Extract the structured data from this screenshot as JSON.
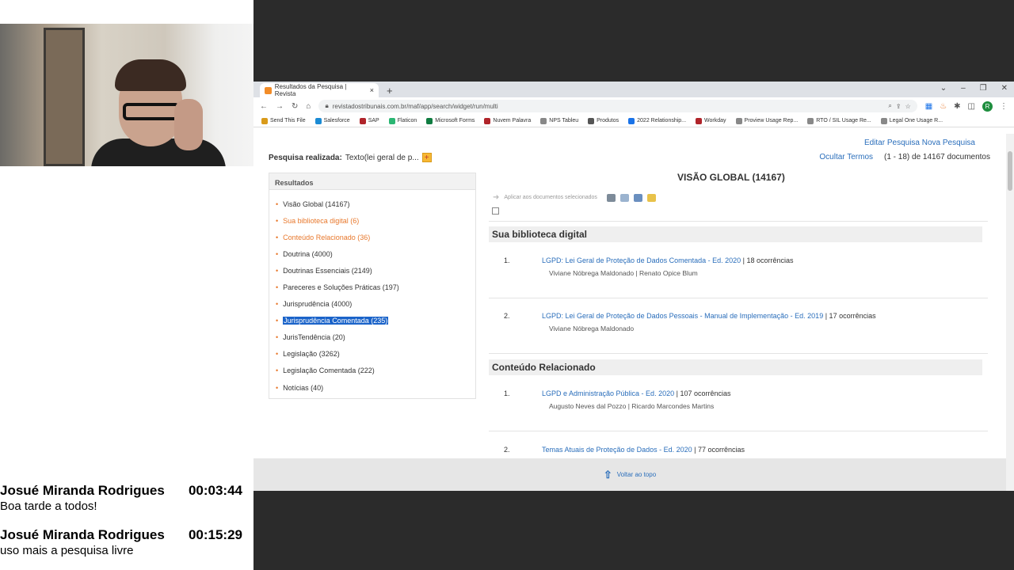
{
  "chat": [
    {
      "name": "Josué Miranda Rodrigues",
      "time": "00:03:44",
      "text": "Boa tarde a todos!"
    },
    {
      "name": "Josué Miranda Rodrigues",
      "time": "00:15:29",
      "text": "uso mais a pesquisa livre"
    }
  ],
  "browser": {
    "tab_title": "Resultados da Pesquisa | Revista",
    "tab_close": "×",
    "new_tab": "+",
    "url": "revistadostribunais.com.br/maf/app/search/widget/run/multi",
    "avatar_letter": "R",
    "bookmarks": [
      {
        "label": "Send This File",
        "color": "#d99a1a"
      },
      {
        "label": "Salesforce",
        "color": "#1b8bd4"
      },
      {
        "label": "SAP",
        "color": "#b0242a"
      },
      {
        "label": "Flaticon",
        "color": "#2bb673"
      },
      {
        "label": "Microsoft Forms",
        "color": "#107c41"
      },
      {
        "label": "Nuvem Palavra",
        "color": "#b0242a"
      },
      {
        "label": "NPS Tableu",
        "color": "#888888"
      },
      {
        "label": "Produtos",
        "color": "#555555"
      },
      {
        "label": "2022 Relationship...",
        "color": "#1a73e8"
      },
      {
        "label": "Workday",
        "color": "#b0242a"
      },
      {
        "label": "Proview Usage Rep...",
        "color": "#888888"
      },
      {
        "label": "RTO / SIL Usage Re...",
        "color": "#888888"
      },
      {
        "label": "Legal One Usage R...",
        "color": "#888888"
      }
    ]
  },
  "page": {
    "search_label": "Pesquisa realizada:",
    "search_value": "Texto(lei geral de p...",
    "plus": "+",
    "edit_search": "Editar Pesquisa",
    "new_search": "Nova Pesquisa",
    "hide_terms": "Ocultar Termos",
    "range": "(1 - 18) de 14167 documentos",
    "results_heading": "Resultados",
    "results": [
      {
        "label": "Visão Global (14167)",
        "style": "normal"
      },
      {
        "label": "Sua biblioteca digital (6)",
        "style": "orange"
      },
      {
        "label": "Conteúdo Relacionado (36)",
        "style": "orange"
      },
      {
        "label": "Doutrina (4000)",
        "style": "normal"
      },
      {
        "label": "Doutrinas Essenciais (2149)",
        "style": "normal"
      },
      {
        "label": "Pareceres e Soluções Práticas (197)",
        "style": "normal"
      },
      {
        "label": "Jurisprudência (4000)",
        "style": "normal"
      },
      {
        "label": "Jurisprudência Comentada (235)",
        "style": "selected"
      },
      {
        "label": "JurisTendência (20)",
        "style": "normal"
      },
      {
        "label": "Legislação (3262)",
        "style": "normal"
      },
      {
        "label": "Legislação Comentada (222)",
        "style": "normal"
      },
      {
        "label": "Notícias (40)",
        "style": "normal"
      }
    ],
    "main_title": "VISÃO GLOBAL (14167)",
    "apply_label": "Aplicar aos documentos selecionados",
    "sections": [
      {
        "title": "Sua biblioteca digital",
        "docs": [
          {
            "num": "1.",
            "title": "LGPD: Lei Geral de Proteção de Dados Comentada - Ed. 2020",
            "occ": "| 18 ocorrências",
            "authors": "Viviane Nóbrega Maldonado | Renato Opice Blum"
          },
          {
            "num": "2.",
            "title": "LGPD: Lei Geral de Proteção de Dados Pessoais - Manual de Implementação - Ed. 2019",
            "occ": "| 17 ocorrências",
            "authors": "Viviane Nóbrega Maldonado"
          }
        ]
      },
      {
        "title": "Conteúdo Relacionado",
        "docs": [
          {
            "num": "1.",
            "title": "LGPD e Administração Pública - Ed. 2020",
            "occ": "| 107 ocorrências",
            "authors": "Augusto Neves dal Pozzo | Ricardo Marcondes Martins"
          },
          {
            "num": "2.",
            "title": "Temas Atuais de Proteção de Dados - Ed. 2020",
            "occ": "| 77 ocorrências",
            "authors": ""
          }
        ]
      }
    ],
    "back_to_top": "Voltar ao topo"
  }
}
